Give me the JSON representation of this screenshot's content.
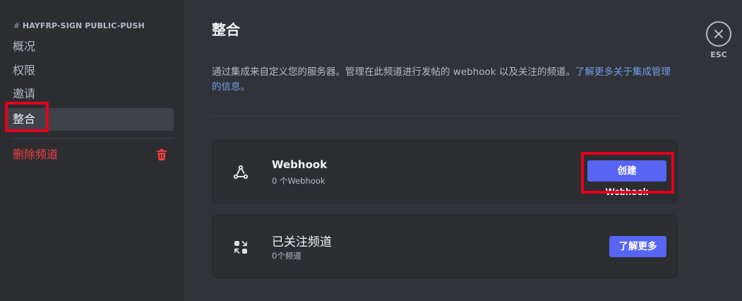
{
  "sidebar": {
    "channel_header": "HAYFRP-SIGN PUBLIC-PUSH",
    "items": [
      {
        "label": "概况"
      },
      {
        "label": "权限"
      },
      {
        "label": "邀请"
      },
      {
        "label": "整合"
      }
    ],
    "delete_label": "删除频道"
  },
  "main": {
    "title": "整合",
    "description": "通过集成来自定义您的服务器。管理在此频道进行发帖的 webhook 以及关注的频道。",
    "learn_more_link": "了解更多关于集成管理的信息。",
    "cards": [
      {
        "title": "Webhook",
        "subtitle": "0 个Webhook",
        "button": "创建 Webhook",
        "icon": "webhook-icon"
      },
      {
        "title": "已关注频道",
        "subtitle": "0个频道",
        "button": "了解更多",
        "icon": "followed-channels-icon"
      }
    ]
  },
  "close": {
    "label": "ESC",
    "icon": "close-icon"
  },
  "colors": {
    "accent": "#5865f2",
    "danger": "#f23f42",
    "highlight": "#e3001b",
    "link": "#6f9eea"
  }
}
